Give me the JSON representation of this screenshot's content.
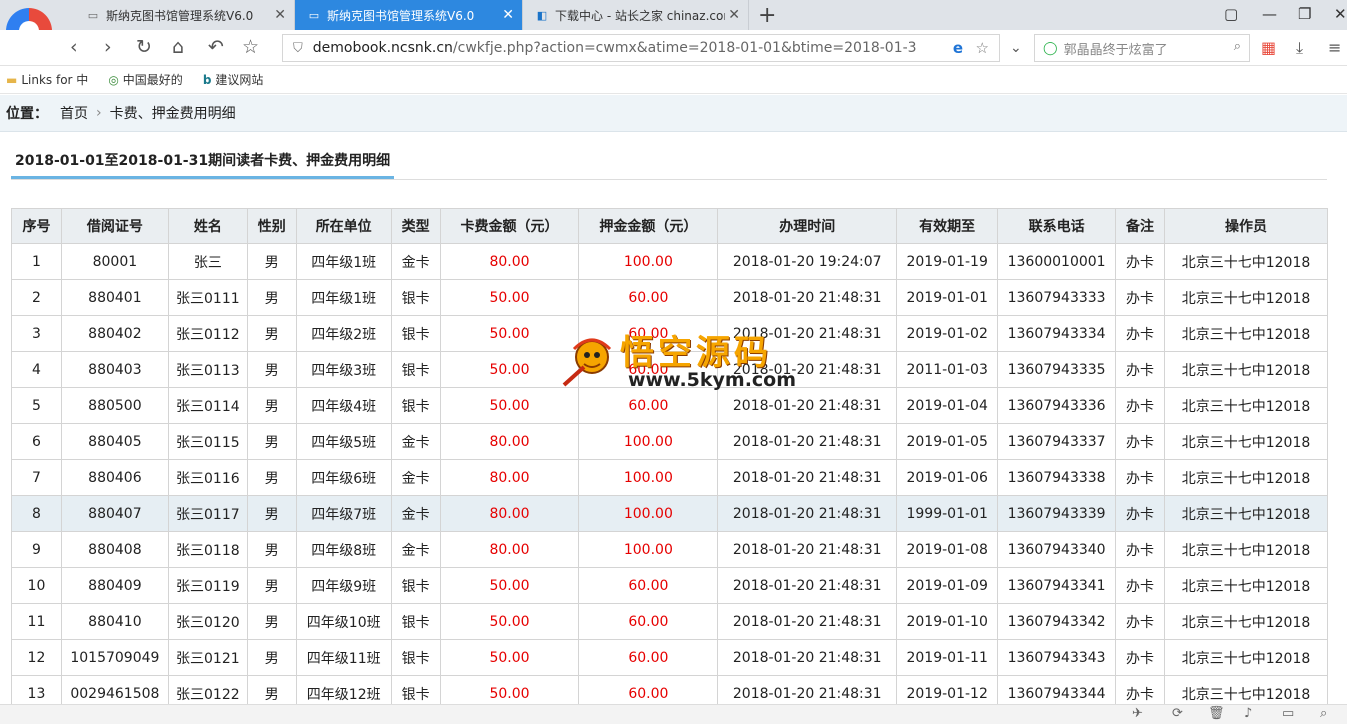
{
  "browser": {
    "tabs": [
      {
        "title": "斯纳克图书馆管理系统V6.0",
        "active": false
      },
      {
        "title": "斯纳克图书馆管理系统V6.0",
        "active": true
      },
      {
        "title": "下载中心 - 站长之家 chinaz.com",
        "active": false
      }
    ],
    "url_host": "demobook.ncsnk.cn",
    "url_path": "/cwkfje.php?action=cwmx&atime=2018-01-01&btime=2018-01-3",
    "search_placeholder": "郭晶晶终于炫富了",
    "bookmarks": [
      "Links for 中",
      "中国最好的",
      "建议网站"
    ]
  },
  "breadcrumb": {
    "label": "位置：",
    "home": "首页",
    "current": "卡费、押金费用明细"
  },
  "page_heading": "2018-01-01至2018-01-31期间读者卡费、押金费用明细",
  "table": {
    "columns": [
      "序号",
      "借阅证号",
      "姓名",
      "性别",
      "所在单位",
      "类型",
      "卡费金额（元）",
      "押金金额（元）",
      "办理时间",
      "有效期至",
      "联系电话",
      "备注",
      "操作员"
    ],
    "rows": [
      [
        "1",
        "80001",
        "张三",
        "男",
        "四年级1班",
        "金卡",
        "80.00",
        "100.00",
        "2018-01-20 19:24:07",
        "2019-01-19",
        "13600010001",
        "办卡",
        "北京三十七中12018"
      ],
      [
        "2",
        "880401",
        "张三0111",
        "男",
        "四年级1班",
        "银卡",
        "50.00",
        "60.00",
        "2018-01-20 21:48:31",
        "2019-01-01",
        "13607943333",
        "办卡",
        "北京三十七中12018"
      ],
      [
        "3",
        "880402",
        "张三0112",
        "男",
        "四年级2班",
        "银卡",
        "50.00",
        "60.00",
        "2018-01-20 21:48:31",
        "2019-01-02",
        "13607943334",
        "办卡",
        "北京三十七中12018"
      ],
      [
        "4",
        "880403",
        "张三0113",
        "男",
        "四年级3班",
        "银卡",
        "50.00",
        "60.00",
        "2018-01-20 21:48:31",
        "2011-01-03",
        "13607943335",
        "办卡",
        "北京三十七中12018"
      ],
      [
        "5",
        "880500",
        "张三0114",
        "男",
        "四年级4班",
        "银卡",
        "50.00",
        "60.00",
        "2018-01-20 21:48:31",
        "2019-01-04",
        "13607943336",
        "办卡",
        "北京三十七中12018"
      ],
      [
        "6",
        "880405",
        "张三0115",
        "男",
        "四年级5班",
        "金卡",
        "80.00",
        "100.00",
        "2018-01-20 21:48:31",
        "2019-01-05",
        "13607943337",
        "办卡",
        "北京三十七中12018"
      ],
      [
        "7",
        "880406",
        "张三0116",
        "男",
        "四年级6班",
        "金卡",
        "80.00",
        "100.00",
        "2018-01-20 21:48:31",
        "2019-01-06",
        "13607943338",
        "办卡",
        "北京三十七中12018"
      ],
      [
        "8",
        "880407",
        "张三0117",
        "男",
        "四年级7班",
        "金卡",
        "80.00",
        "100.00",
        "2018-01-20 21:48:31",
        "1999-01-01",
        "13607943339",
        "办卡",
        "北京三十七中12018"
      ],
      [
        "9",
        "880408",
        "张三0118",
        "男",
        "四年级8班",
        "金卡",
        "80.00",
        "100.00",
        "2018-01-20 21:48:31",
        "2019-01-08",
        "13607943340",
        "办卡",
        "北京三十七中12018"
      ],
      [
        "10",
        "880409",
        "张三0119",
        "男",
        "四年级9班",
        "银卡",
        "50.00",
        "60.00",
        "2018-01-20 21:48:31",
        "2019-01-09",
        "13607943341",
        "办卡",
        "北京三十七中12018"
      ],
      [
        "11",
        "880410",
        "张三0120",
        "男",
        "四年级10班",
        "银卡",
        "50.00",
        "60.00",
        "2018-01-20 21:48:31",
        "2019-01-10",
        "13607943342",
        "办卡",
        "北京三十七中12018"
      ],
      [
        "12",
        "1015709049",
        "张三0121",
        "男",
        "四年级11班",
        "银卡",
        "50.00",
        "60.00",
        "2018-01-20 21:48:31",
        "2019-01-11",
        "13607943343",
        "办卡",
        "北京三十七中12018"
      ],
      [
        "13",
        "0029461508",
        "张三0122",
        "男",
        "四年级12班",
        "银卡",
        "50.00",
        "60.00",
        "2018-01-20 21:48:31",
        "2019-01-12",
        "13607943344",
        "办卡",
        "北京三十七中12018"
      ]
    ],
    "highlighted_row": 8,
    "amount_color": "#e60000"
  },
  "watermark": {
    "title": "悟空源码",
    "url": "www.5kym.com"
  },
  "icons": {
    "back": "back-arrow-icon",
    "forward": "forward-arrow-icon",
    "reload": "reload-icon",
    "home": "home-icon",
    "undo": "undo-icon",
    "favorite": "star-icon"
  }
}
